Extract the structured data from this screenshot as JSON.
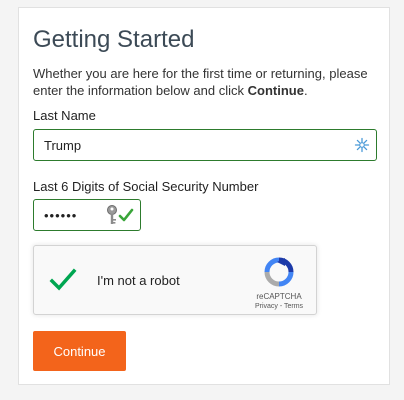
{
  "form": {
    "title": "Getting Started",
    "intro_text": "Whether you are here for the first time or returning, please enter the information below and click ",
    "intro_bold": "Continue",
    "intro_end": ".",
    "last_name_label": "Last Name",
    "last_name_value": "Trump",
    "ssn_label": "Last 6 Digits of Social Security Number",
    "ssn_value": "••••••",
    "continue_label": "Continue"
  },
  "recaptcha": {
    "checkbox_label": "I'm not a robot",
    "brand": "reCAPTCHA",
    "links": "Privacy - Terms",
    "checked": true
  },
  "icons": {
    "last_name_field_icon": "sparkle-icon",
    "ssn_field_icon": "key-icon",
    "checkbox_icon": "checkmark-icon",
    "captcha_logo": "recaptcha-logo-icon"
  },
  "colors": {
    "accent_button": "#f3641b",
    "field_border": "#2d7b2d",
    "check_green": "#00a651",
    "title": "#3c4a56"
  }
}
